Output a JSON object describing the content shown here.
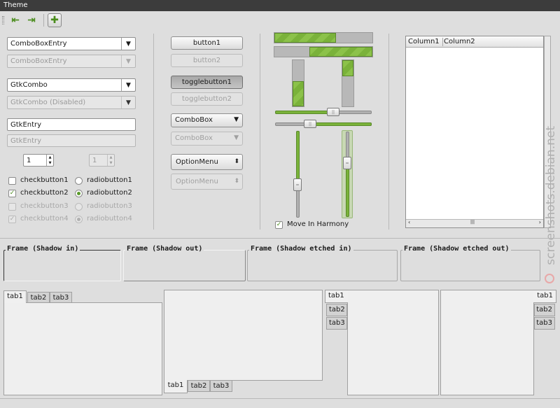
{
  "window": {
    "title": "Theme"
  },
  "toolbar": {
    "icons": [
      "go-first-icon",
      "go-last-icon",
      "add-icon"
    ],
    "accent_color": "#6aa82e"
  },
  "combos": {
    "comboboxentry": "ComboBoxEntry",
    "comboboxentry_disabled": "ComboBoxEntry",
    "gtkcombo": "GtkCombo",
    "gtkcombo_disabled": "GtkCombo (Disabled)"
  },
  "entries": {
    "gtkentry": "GtkEntry",
    "gtkentry_disabled": "GtkEntry"
  },
  "spins": {
    "enabled_value": "1",
    "disabled_value": "1"
  },
  "checks": {
    "check1": "checkbutton1",
    "check2": "checkbutton2",
    "check3": "checkbutton3",
    "check4": "checkbutton4"
  },
  "radios": {
    "radio1": "radiobutton1",
    "radio2": "radiobutton2",
    "radio3": "radiobutton3",
    "radio4": "radiobutton4"
  },
  "buttons": {
    "button1": "button1",
    "button2": "button2",
    "toggle1": "togglebutton1",
    "toggle2": "togglebutton2"
  },
  "combobox": {
    "enabled": "ComboBox",
    "disabled": "ComboBox"
  },
  "optionmenu": {
    "enabled": "OptionMenu",
    "disabled": "OptionMenu"
  },
  "progress": {
    "h1_fraction": 0.63,
    "h2_fraction": 0.64,
    "v1_fraction": 0.55,
    "v2_fraction": 0.35
  },
  "scales": {
    "h1_value": 0.6,
    "h2_value": 0.36,
    "v1_value": 0.62,
    "v2_value": 0.37
  },
  "harmony": {
    "label": "Move In Harmony"
  },
  "treeview": {
    "columns": [
      "Column1",
      "Column2"
    ]
  },
  "frames": {
    "shadow_in": "Frame (Shadow in)",
    "shadow_out": "Frame (Shadow out)",
    "shadow_etched_in": "Frame (Shadow etched in)",
    "shadow_etched_out": "Frame (Shadow etched out)"
  },
  "notebooks": {
    "tabs": [
      "tab1",
      "tab2",
      "tab3"
    ]
  },
  "watermark": "screenshots.debian.net"
}
